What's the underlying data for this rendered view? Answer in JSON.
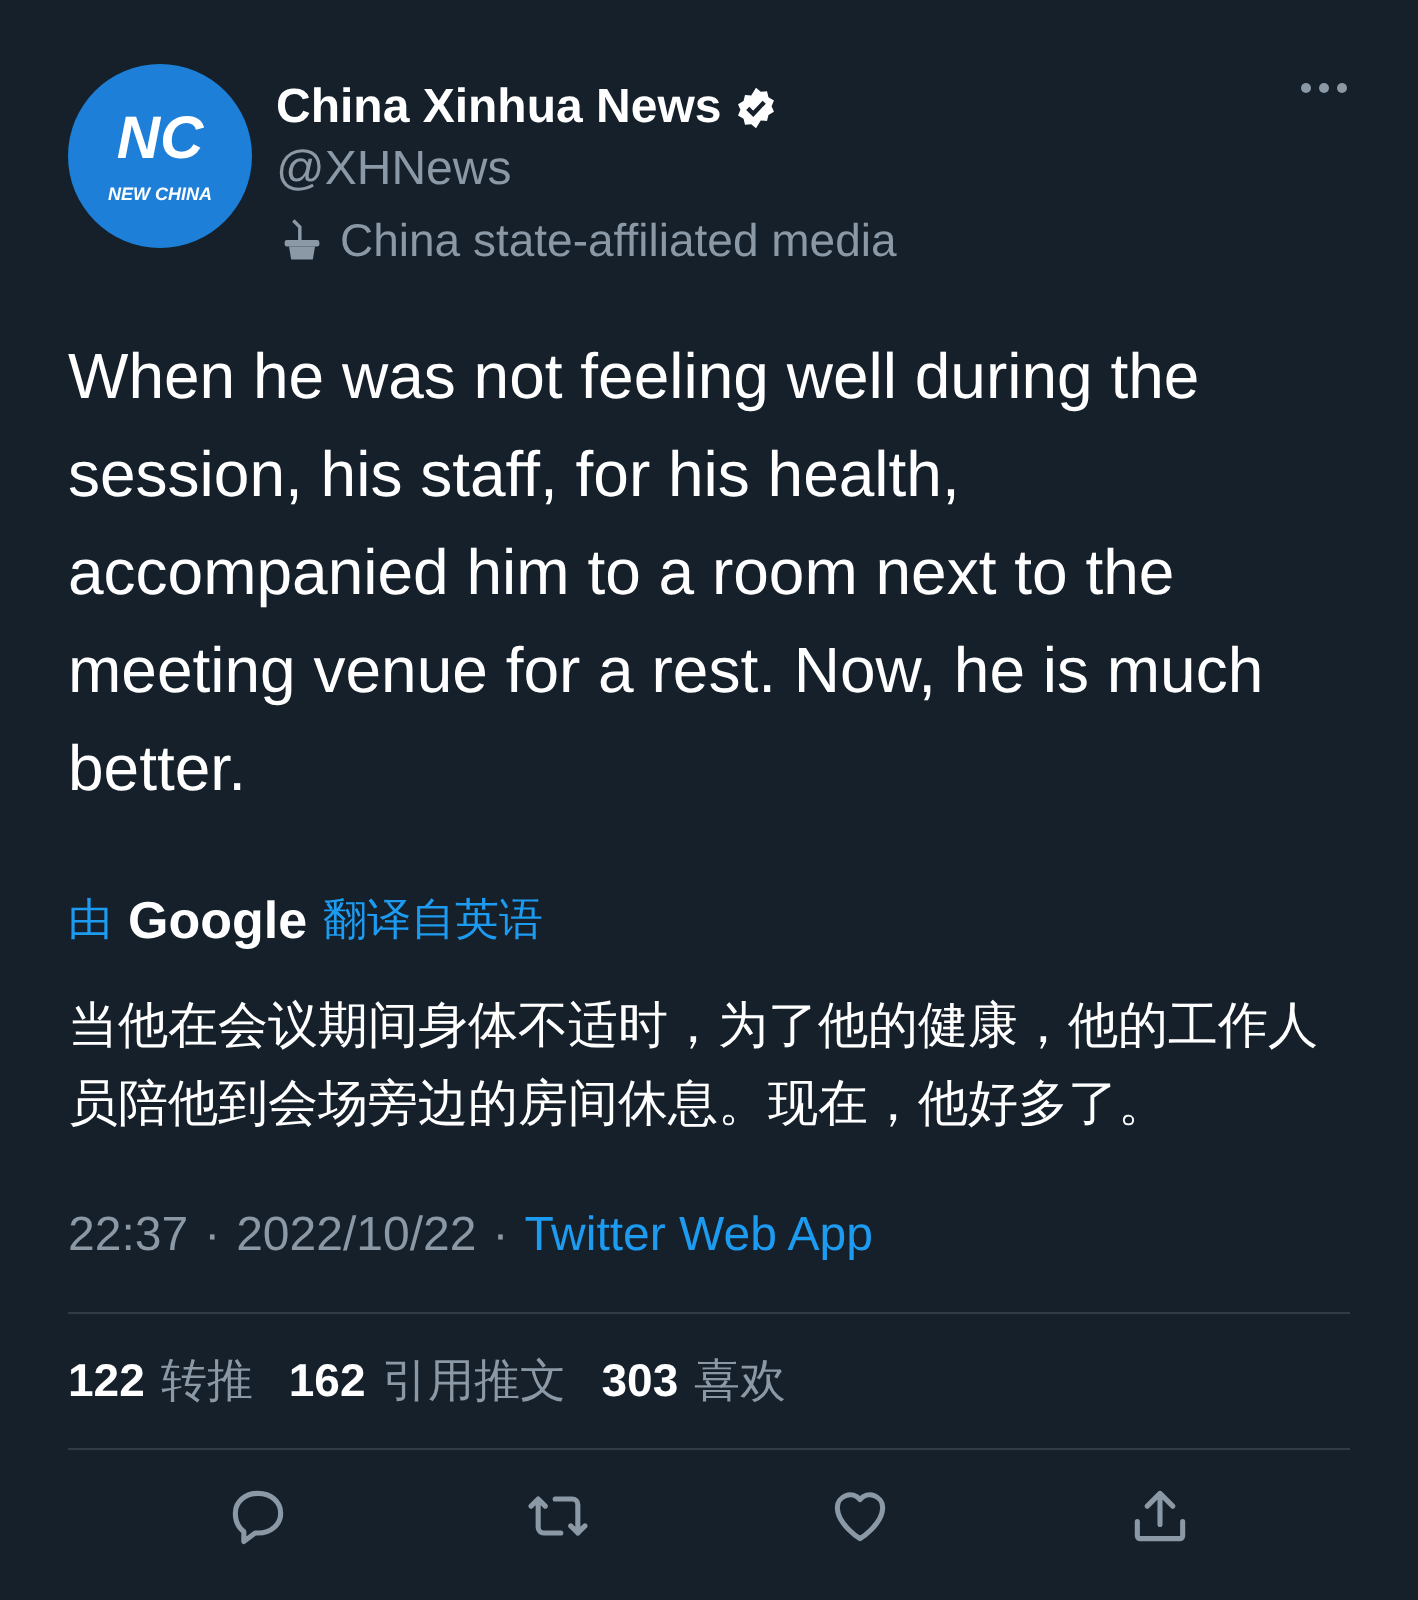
{
  "author": {
    "avatar_monogram": "NC",
    "avatar_caption": "NEW CHINA",
    "name": "China Xinhua News",
    "verified": true,
    "handle": "@XHNews",
    "label": "China state-affiliated media"
  },
  "tweet": {
    "text": "When he was not feeling well during the session, his staff, for his health, accompanied him to a room next to the meeting venue for a rest. Now, he is much better."
  },
  "translation": {
    "by": "由",
    "brand": "Google",
    "from": "翻译自英语",
    "text": "当他在会议期间身体不适时，为了他的健康，他的工作人员陪他到会场旁边的房间休息。现在，他好多了。"
  },
  "meta": {
    "time": "22:37",
    "separator": "·",
    "date": "2022/10/22",
    "source": "Twitter Web App"
  },
  "stats": [
    {
      "count": "122",
      "label": "转推"
    },
    {
      "count": "162",
      "label": "引用推文"
    },
    {
      "count": "303",
      "label": "喜欢"
    }
  ],
  "actions": [
    {
      "kind": "reply"
    },
    {
      "kind": "retweet"
    },
    {
      "kind": "like"
    },
    {
      "kind": "share"
    }
  ]
}
